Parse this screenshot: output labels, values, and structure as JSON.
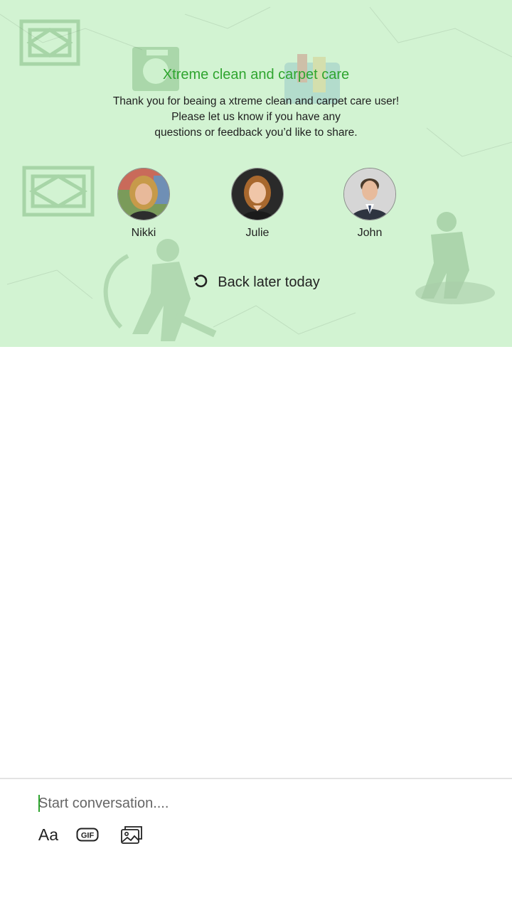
{
  "header": {
    "title": "Xtreme clean and carpet care",
    "subtitle_lines": [
      "Thank you for beaing a xtreme clean and carpet care user!",
      "Please let us know if you have any",
      "questions or feedback you’d like to share."
    ],
    "accent_color": "#2fa52f",
    "background_color": "#d2f3d2"
  },
  "agents": [
    {
      "name": "Nikki",
      "avatar": "avatar-woman-blonde"
    },
    {
      "name": "Julie",
      "avatar": "avatar-woman-auburn"
    },
    {
      "name": "John",
      "avatar": "avatar-man-suit"
    }
  ],
  "status": {
    "label": "Back later today",
    "icon": "history-icon"
  },
  "composer": {
    "placeholder": "Start conversation....",
    "value": "",
    "tools": [
      {
        "label": "Aa",
        "icon": "text-format-icon"
      },
      {
        "label": "GIF",
        "icon": "gif-icon"
      },
      {
        "label": "",
        "icon": "image-gallery-icon"
      }
    ]
  }
}
